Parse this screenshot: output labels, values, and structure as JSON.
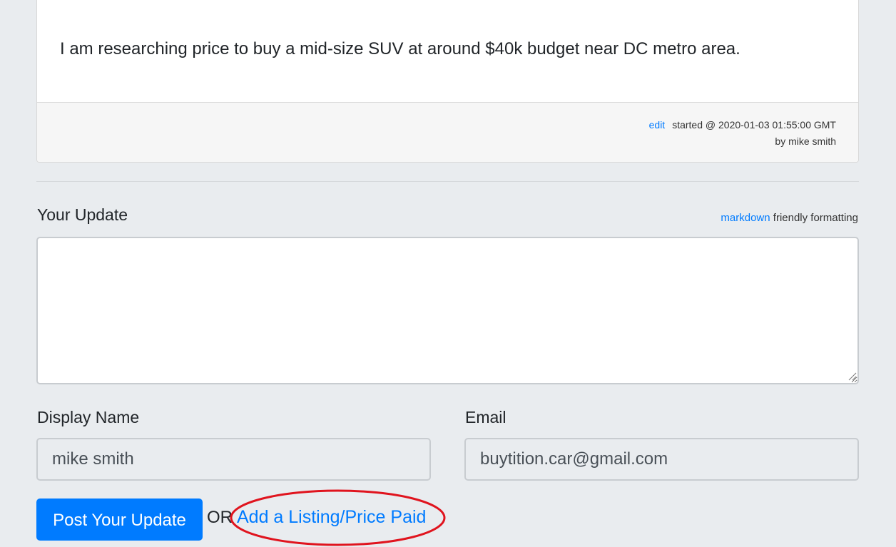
{
  "topic": {
    "body_text": "I am researching price to buy a mid-size SUV at around $40k budget near DC metro area.",
    "edit_label": "edit",
    "started_text": "started @ 2020-01-03 01:55:00 GMT",
    "author_text": "by mike smith"
  },
  "update_form": {
    "title": "Your Update",
    "hint_link": "markdown",
    "hint_text": " friendly formatting",
    "textarea_value": "",
    "display_name_label": "Display Name",
    "display_name_value": "mike smith",
    "email_label": "Email",
    "email_value": "buytition.car@gmail.com",
    "post_button_label": "Post Your Update",
    "or_text": "OR",
    "add_listing_label": "Add a Listing/Price Paid"
  },
  "colors": {
    "background": "#e9ecef",
    "accent": "#007bff",
    "annotation_circle": "#e0141e"
  }
}
